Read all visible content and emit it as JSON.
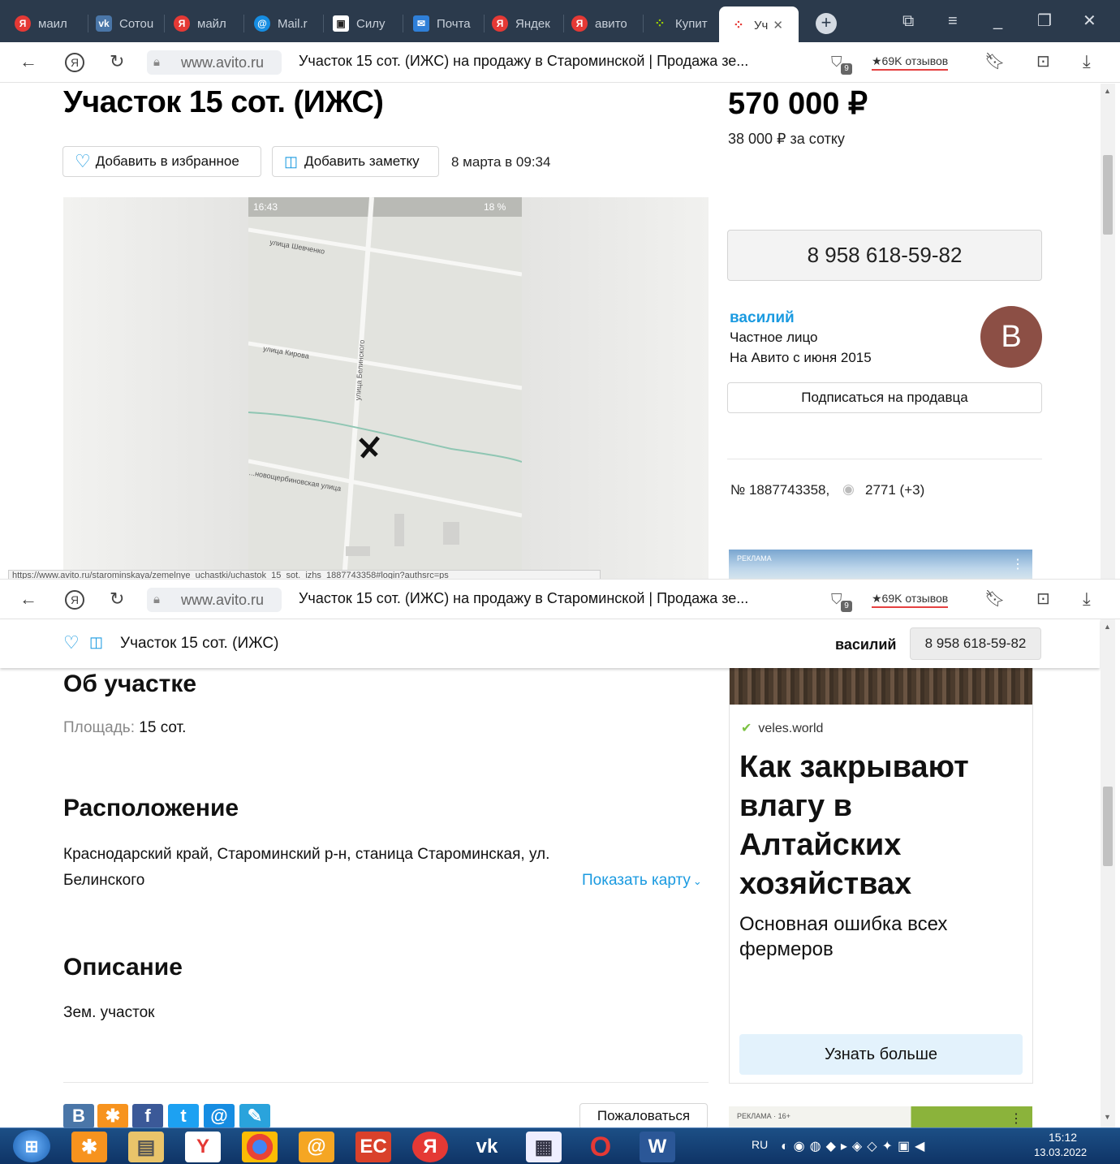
{
  "browser": {
    "tabs": [
      {
        "label": "маил",
        "icon": "yandex-icon",
        "color": "#e53935"
      },
      {
        "label": "Сотоu",
        "icon": "vk-icon",
        "color": "#4a76a8"
      },
      {
        "label": "майл",
        "icon": "yandex-icon",
        "color": "#e53935"
      },
      {
        "label": "Mail.r",
        "icon": "mailru-icon",
        "color": "#168de2"
      },
      {
        "label": "Силу",
        "icon": "video-icon",
        "color": "#ffffff"
      },
      {
        "label": "Почта",
        "icon": "mail-icon",
        "color": "#2f7fd8"
      },
      {
        "label": "Яндек",
        "icon": "yandex-icon",
        "color": "#e53935"
      },
      {
        "label": "авито",
        "icon": "yandex-icon",
        "color": "#e53935"
      },
      {
        "label": "Купит",
        "icon": "avito-icon",
        "color": "#99cc00"
      },
      {
        "label": "Уч",
        "icon": "avito-icon",
        "color": "#99cc00",
        "active": true
      }
    ],
    "url_domain": "www.avito.ru",
    "page_title": "Участок 15 сот. (ИЖС) на продажу в Староминской | Продажа зе...",
    "reviews": "★69K отзывов",
    "shield_count": "9",
    "status_url": "https://www.avito.ru/starominskaya/zemelnye_uchastki/uchastok_15_sot._izhs_1887743358#login?authsrc=ps"
  },
  "listing": {
    "title": "Участок 15 сот. (ИЖС)",
    "price": "570 000 ₽",
    "price_per": "38 000 ₽ за сотку",
    "add_favorite": "Добавить в избранное",
    "add_note": "Добавить заметку",
    "date": "8 марта в 09:34",
    "phone": "8 958 618-59-82",
    "seller_name": "василий",
    "seller_type": "Частное лицо",
    "seller_since": "На Авито с июня 2015",
    "seller_initial": "В",
    "subscribe": "Подписаться на продавца",
    "number": "№ 1887743358,",
    "views": "2771 (+3)",
    "ad_label": "РЕКЛАМА"
  },
  "map": {
    "status_time": "16:43",
    "status_battery": "18 %",
    "street_1": "улица Шевченко",
    "street_2": "улица Кирова",
    "street_3": "улица Белинского",
    "street_4": "...новощербиновская улица"
  },
  "sticky": {
    "title": "Участок 15 сот. (ИЖС)",
    "seller": "василий",
    "phone": "8 958 618-59-82"
  },
  "about": {
    "heading": "Об участке",
    "area_label": "Площадь:",
    "area_value": "15 сот."
  },
  "location": {
    "heading": "Расположение",
    "line1": "Краснодарский край, Староминский р-н, станица Староминская, ул.",
    "line2": "Белинского",
    "show_map": "Показать карту"
  },
  "description": {
    "heading": "Описание",
    "text": "Зем. участок"
  },
  "advert": {
    "source": "veles.world",
    "headline": "Как закрывают влагу в Алтайских хозяйствах",
    "subtitle": "Основная ошибка всех фермеров",
    "button": "Узнать больше",
    "ad2_label": "РЕКЛАМА · 16+"
  },
  "complain": "Пожаловаться",
  "taskbar": {
    "lang": "RU",
    "time": "15:12",
    "date": "13.03.2022"
  }
}
